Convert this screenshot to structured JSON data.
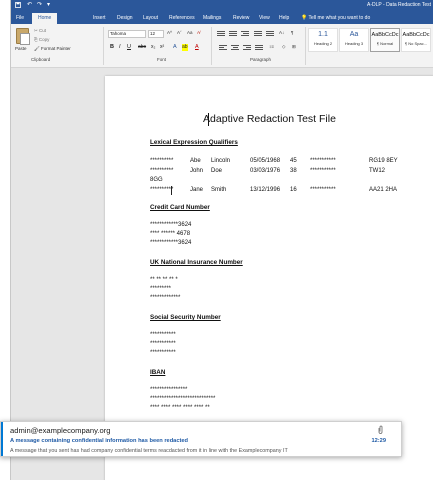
{
  "window": {
    "title": "A-DLP - Data Redaction Test"
  },
  "ribbon": {
    "tabs": [
      {
        "label": "File"
      },
      {
        "label": "Home"
      },
      {
        "label": "Insert"
      },
      {
        "label": "Design"
      },
      {
        "label": "Layout"
      },
      {
        "label": "References"
      },
      {
        "label": "Mailings"
      },
      {
        "label": "Review"
      },
      {
        "label": "View"
      },
      {
        "label": "Help"
      }
    ],
    "tell_me": "Tell me what you want to do",
    "clipboard": {
      "paste": "Paste",
      "cut": "Cut",
      "copy": "Copy",
      "format_painter": "Format Painter",
      "group_label": "Clipboard"
    },
    "font": {
      "name": "Tahoma",
      "size": "12",
      "group_label": "Font",
      "bold": "B",
      "italic": "I",
      "underline": "U",
      "strike": "abc",
      "subscript": "x₂",
      "superscript": "x²",
      "case": "Aa",
      "highlight": "ab",
      "color": "A"
    },
    "paragraph": {
      "group_label": "Paragraph"
    },
    "styles": [
      {
        "preview": "1.1",
        "name": "Heading 2"
      },
      {
        "preview": "Aa",
        "name": "Heading 3"
      },
      {
        "preview": "AaBbCcDc",
        "name": "¶ Normal"
      },
      {
        "preview": "AaBbCcDc",
        "name": "¶ No Spac..."
      }
    ]
  },
  "document": {
    "title": "Adaptive Redaction Test File",
    "sections": [
      {
        "heading": "Lexical Expression Qualifiers",
        "lines": [
          [
            "**********",
            "Abe",
            "Lincoln",
            "05/05/1968",
            "45",
            "***********",
            "RG19 8EY"
          ],
          [
            "**********",
            "John",
            "Doe",
            "03/03/1976",
            "38",
            "***********",
            "TW12"
          ],
          [
            "8GG"
          ],
          [
            "**********",
            "Jane",
            "Smith",
            "13/12/1996",
            "16",
            "***********",
            "AA21 2HA"
          ]
        ]
      },
      {
        "heading": "Credit Card Number",
        "lines": [
          "************3624",
          "**** ****** 4678",
          "************3624"
        ]
      },
      {
        "heading": "UK National Insurance Number",
        "lines": [
          "** ** ** ** *",
          "*********",
          "*************"
        ]
      },
      {
        "heading": "Social Security Number",
        "lines": [
          "***********",
          "***********",
          "***********"
        ]
      },
      {
        "heading": "IBAN",
        "lines": [
          "****************",
          "****************************",
          "**** **** **** **** **** **"
        ]
      }
    ]
  },
  "notification": {
    "sender": "admin@examplecompany.org",
    "subject": "A message containing confidential information has been redacted",
    "time": "12:29",
    "preview": "A message that you sent has had company confidential terms reacdacted from it in line with the Examplecompany IT"
  }
}
